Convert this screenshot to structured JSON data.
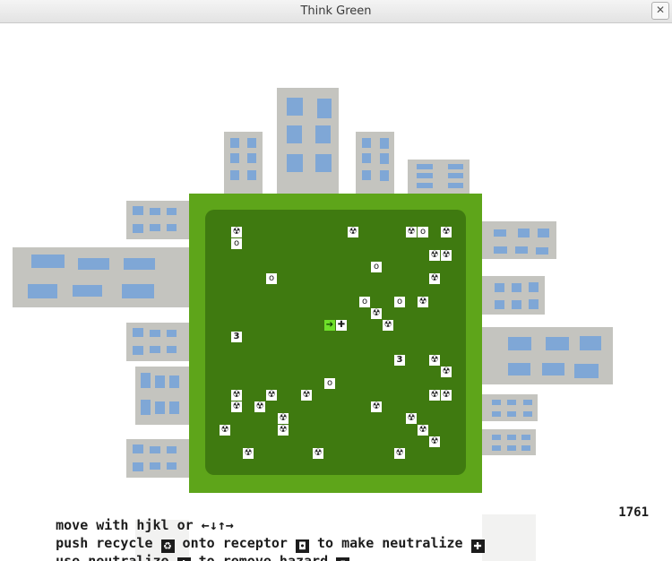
{
  "window": {
    "title": "Think Green",
    "close_label": "✕"
  },
  "icons": {
    "recycle": "♻",
    "receptor": "◘",
    "neutralize": "✚",
    "hazard": "☢",
    "player": "➔"
  },
  "colors": {
    "platform": "#5ea51a",
    "board": "#3f7a10",
    "building": "#c4c4bf",
    "window": "#7fa7d6"
  },
  "board": {
    "tiles": [
      {
        "kind": "hazard",
        "g": "☢"
      },
      {
        "kind": "receptor",
        "g": "o"
      },
      {
        "kind": "hazard",
        "g": "☢"
      },
      {
        "kind": "hazard",
        "g": "☢"
      },
      {
        "kind": "receptor",
        "g": "o"
      },
      {
        "kind": "hazard",
        "g": "☢"
      },
      {
        "kind": "hazard",
        "g": "☢"
      },
      {
        "kind": "hazard",
        "g": "☢"
      },
      {
        "kind": "receptor",
        "g": "o"
      },
      {
        "kind": "receptor",
        "g": "o"
      },
      {
        "kind": "hazard",
        "g": "☢"
      },
      {
        "kind": "receptor",
        "g": "o"
      },
      {
        "kind": "receptor",
        "g": "o"
      },
      {
        "kind": "hazard",
        "g": "☢"
      },
      {
        "kind": "hazard",
        "g": "☢"
      },
      {
        "kind": "hazard",
        "g": "☢"
      },
      {
        "kind": "player",
        "g": "➔"
      },
      {
        "kind": "neutralize",
        "g": "✚"
      },
      {
        "kind": "number",
        "g": "3"
      },
      {
        "kind": "number",
        "g": "3"
      },
      {
        "kind": "hazard",
        "g": "☢"
      },
      {
        "kind": "hazard",
        "g": "☢"
      },
      {
        "kind": "receptor",
        "g": "o"
      },
      {
        "kind": "hazard",
        "g": "☢"
      },
      {
        "kind": "hazard",
        "g": "☢"
      },
      {
        "kind": "hazard",
        "g": "☢"
      },
      {
        "kind": "hazard",
        "g": "☢"
      },
      {
        "kind": "hazard",
        "g": "☢"
      },
      {
        "kind": "hazard",
        "g": "☢"
      },
      {
        "kind": "hazard",
        "g": "☢"
      },
      {
        "kind": "hazard",
        "g": "☢"
      },
      {
        "kind": "hazard",
        "g": "☢"
      },
      {
        "kind": "hazard",
        "g": "☢"
      },
      {
        "kind": "hazard",
        "g": "☢"
      },
      {
        "kind": "hazard",
        "g": "☢"
      },
      {
        "kind": "hazard",
        "g": "☢"
      },
      {
        "kind": "hazard",
        "g": "☢"
      },
      {
        "kind": "hazard",
        "g": "☢"
      },
      {
        "kind": "hazard",
        "g": "☢"
      },
      {
        "kind": "hazard",
        "g": "☢"
      },
      {
        "kind": "hazard",
        "g": "☢"
      }
    ]
  },
  "help": {
    "line1": "move with hjkl or ←↓↑→",
    "line2_a": "push recycle ",
    "line2_b": " onto receptor ",
    "line2_c": " to make neutralize ",
    "line3_a": "use neutralize ",
    "line3_b": " to remove hazard "
  },
  "score": "1761"
}
